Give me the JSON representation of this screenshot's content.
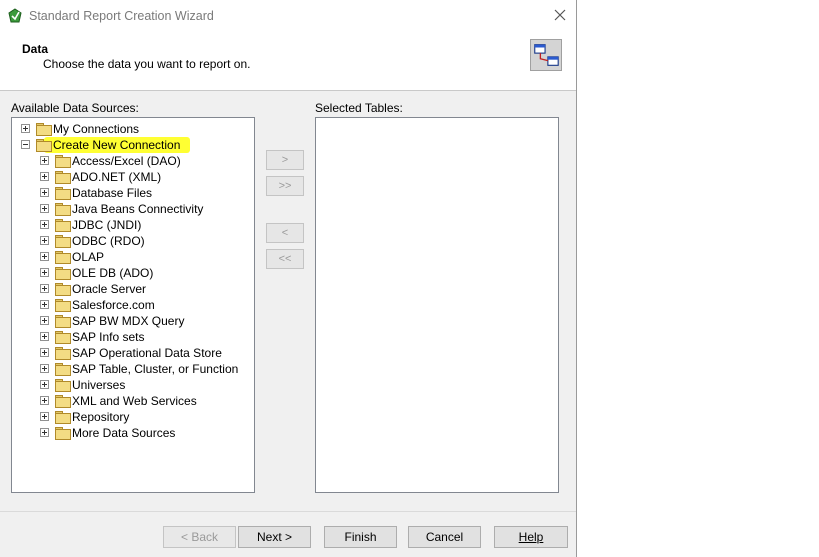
{
  "window": {
    "title": "Standard Report Creation Wizard"
  },
  "header": {
    "title": "Data",
    "subtitle": "Choose the data you want to report on."
  },
  "left_panel": {
    "label": "Available Data Sources:",
    "tree": [
      {
        "label": "My Connections",
        "level": 0,
        "expanded": false
      },
      {
        "label": "Create New Connection",
        "level": 0,
        "expanded": true,
        "highlighted": true
      },
      {
        "label": "Access/Excel (DAO)",
        "level": 1,
        "expanded": false
      },
      {
        "label": "ADO.NET (XML)",
        "level": 1,
        "expanded": false
      },
      {
        "label": "Database Files",
        "level": 1,
        "expanded": false
      },
      {
        "label": "Java Beans Connectivity",
        "level": 1,
        "expanded": false
      },
      {
        "label": "JDBC (JNDI)",
        "level": 1,
        "expanded": false
      },
      {
        "label": "ODBC (RDO)",
        "level": 1,
        "expanded": false
      },
      {
        "label": "OLAP",
        "level": 1,
        "expanded": false
      },
      {
        "label": "OLE DB (ADO)",
        "level": 1,
        "expanded": false
      },
      {
        "label": "Oracle Server",
        "level": 1,
        "expanded": false
      },
      {
        "label": "Salesforce.com",
        "level": 1,
        "expanded": false
      },
      {
        "label": "SAP BW MDX Query",
        "level": 1,
        "expanded": false
      },
      {
        "label": "SAP Info sets",
        "level": 1,
        "expanded": false
      },
      {
        "label": "SAP Operational Data Store",
        "level": 1,
        "expanded": false
      },
      {
        "label": "SAP Table, Cluster, or Function",
        "level": 1,
        "expanded": false
      },
      {
        "label": "Universes",
        "level": 1,
        "expanded": false
      },
      {
        "label": "XML and Web Services",
        "level": 1,
        "expanded": false
      },
      {
        "label": "Repository",
        "level": 1,
        "expanded": false
      },
      {
        "label": "More Data Sources",
        "level": 1,
        "expanded": false
      }
    ]
  },
  "right_panel": {
    "label": "Selected Tables:"
  },
  "move_buttons": {
    "add": ">",
    "add_all": ">>",
    "remove": "<",
    "remove_all": "<<"
  },
  "footer": {
    "back": "< Back",
    "next": "Next >",
    "finish": "Finish",
    "cancel": "Cancel",
    "help": "Help"
  },
  "colors": {
    "highlight": "#ffff33",
    "folder": "#f3dc84"
  }
}
